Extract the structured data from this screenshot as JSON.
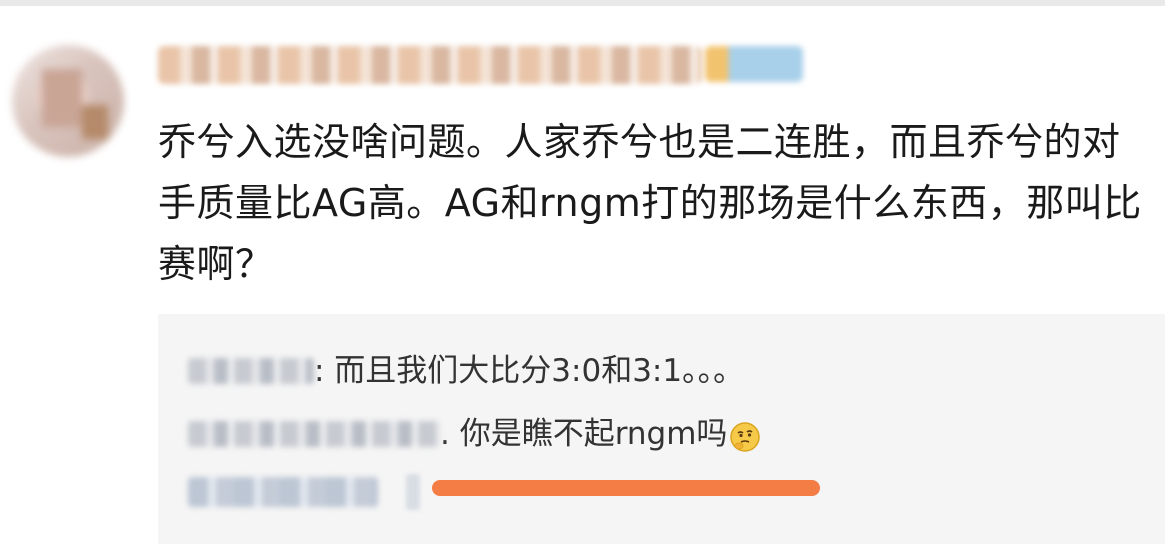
{
  "comment": {
    "text": "乔兮入选没啥问题。人家乔兮也是二连胜，而且乔兮的对手质量比AG高。AG和rngm打的那场是什么东西，那叫比赛啊？"
  },
  "replies": [
    {
      "text": ": 而且我们大比分3:0和3:1。。。"
    },
    {
      "text": ". 你是瞧不起rngm吗",
      "emoji": "thinking-emoji-icon"
    }
  ],
  "colors": {
    "reply_background": "#f5f5f5",
    "highlight_mark": "#f47c45"
  }
}
